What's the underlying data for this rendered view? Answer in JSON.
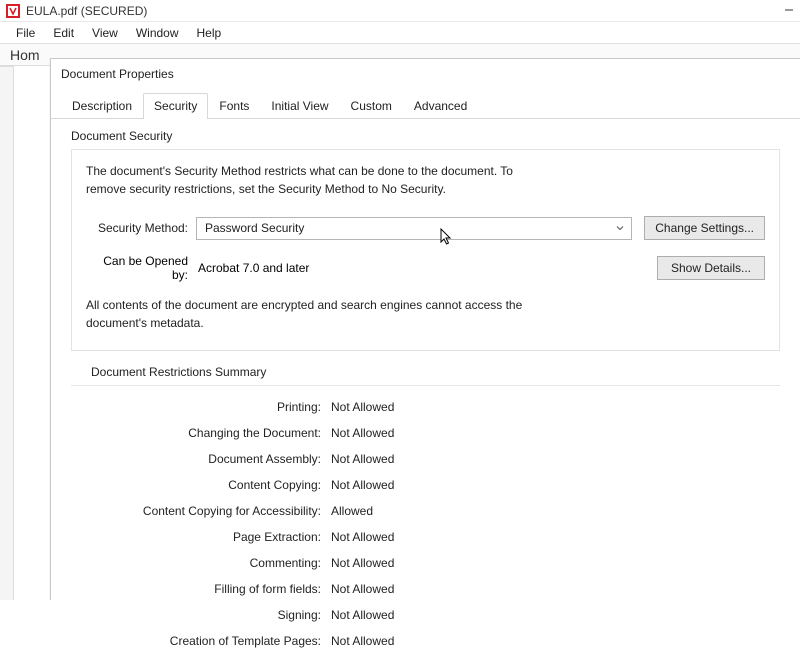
{
  "window": {
    "title": "EULA.pdf (SECURED)"
  },
  "menu": {
    "items": [
      "File",
      "Edit",
      "View",
      "Window",
      "Help"
    ]
  },
  "homeTab": "Hom",
  "dialog": {
    "title": "Document Properties",
    "tabs": [
      "Description",
      "Security",
      "Fonts",
      "Initial View",
      "Custom",
      "Advanced"
    ],
    "security": {
      "groupLabel": "Document Security",
      "description": "The document's Security Method restricts what can be done to the document. To remove security restrictions, set the Security Method to No Security.",
      "securityMethodLabel": "Security Method:",
      "securityMethodValue": "Password Security",
      "changeSettingsLabel": "Change Settings...",
      "openedByLabel": "Can be Opened by:",
      "openedByValue": "Acrobat 7.0 and later",
      "showDetailsLabel": "Show Details...",
      "encryptionNote": "All contents of the document are encrypted and search engines cannot access the document's metadata."
    },
    "restrictions": {
      "title": "Document Restrictions Summary",
      "items": [
        {
          "label": "Printing:",
          "value": "Not Allowed"
        },
        {
          "label": "Changing the Document:",
          "value": "Not Allowed"
        },
        {
          "label": "Document Assembly:",
          "value": "Not Allowed"
        },
        {
          "label": "Content Copying:",
          "value": "Not Allowed"
        },
        {
          "label": "Content Copying for Accessibility:",
          "value": "Allowed"
        },
        {
          "label": "Page Extraction:",
          "value": "Not Allowed"
        },
        {
          "label": "Commenting:",
          "value": "Not Allowed"
        },
        {
          "label": "Filling of form fields:",
          "value": "Not Allowed"
        },
        {
          "label": "Signing:",
          "value": "Not Allowed"
        },
        {
          "label": "Creation of Template Pages:",
          "value": "Not Allowed"
        }
      ]
    }
  }
}
